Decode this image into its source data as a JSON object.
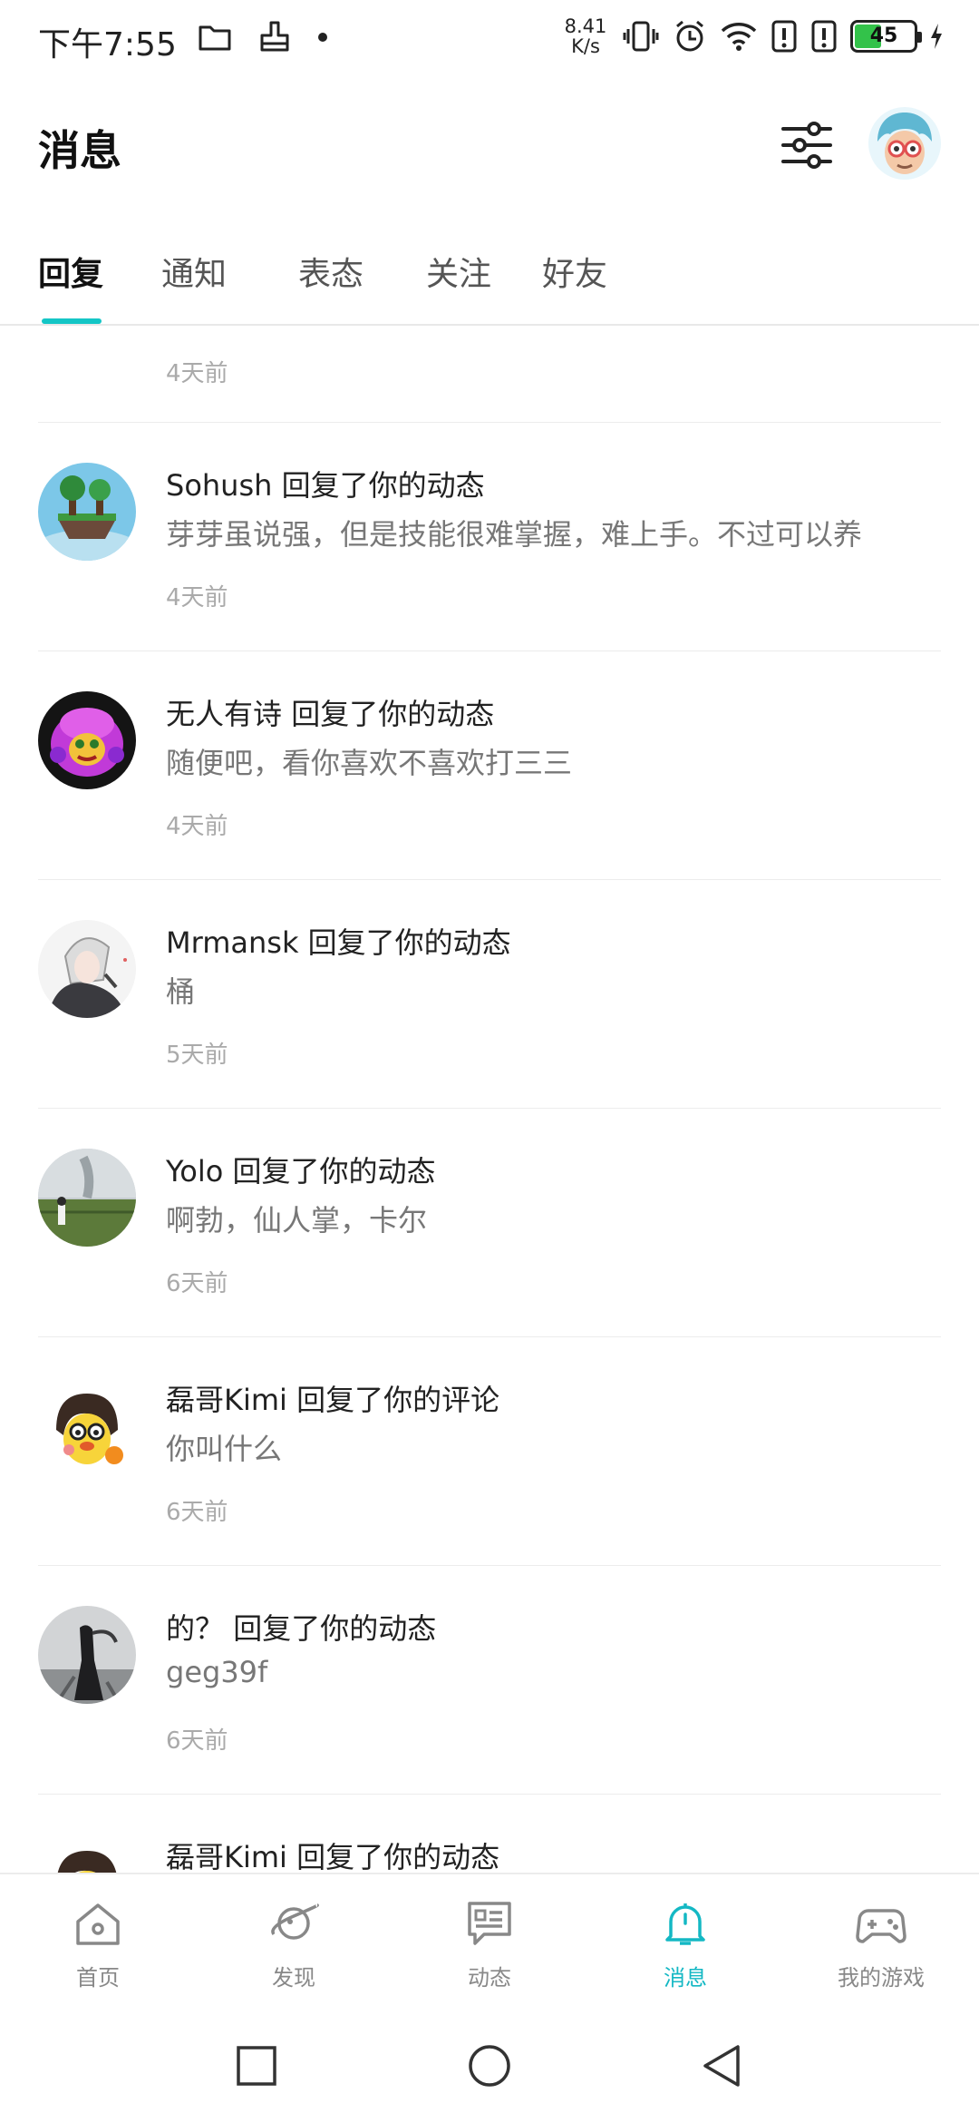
{
  "status_bar": {
    "time": "下午7:55",
    "net_speed": "8.41",
    "net_unit": "K/s",
    "battery": "45",
    "battery_color": "#33c24a"
  },
  "header": {
    "title": "消息"
  },
  "tabs": [
    {
      "label": "回复",
      "active": true
    },
    {
      "label": "通知",
      "active": false
    },
    {
      "label": "表态",
      "active": false
    },
    {
      "label": "关注",
      "active": false
    },
    {
      "label": "好友",
      "active": false
    }
  ],
  "accent_color": "#14c6c6",
  "feed": {
    "first_time": "4天前",
    "messages": [
      {
        "user": "Sohush",
        "action": "回复了你的动态",
        "body": "芽芽虽说强，但是技能很难掌握，难上手。不过可以养",
        "time": "4天前"
      },
      {
        "user": "无人有诗",
        "action": "回复了你的动态",
        "body": "随便吧，看你喜欢不喜欢打三三",
        "time": "4天前"
      },
      {
        "user": "Mrmansk",
        "action": "回复了你的动态",
        "body": "桶",
        "time": "5天前"
      },
      {
        "user": "Yolo",
        "action": "回复了你的动态",
        "body": "啊勃，仙人掌，卡尔",
        "time": "6天前"
      },
      {
        "user": "磊哥Kimi",
        "action": "回复了你的评论",
        "body": "你叫什么",
        "time": "6天前"
      },
      {
        "user": "的？",
        "action": "回复了你的动态",
        "body": "geg39f",
        "time": "6天前"
      },
      {
        "user": "磊哥Kimi",
        "action": "回复了你的动态",
        "body": "",
        "time": ""
      }
    ]
  },
  "bottom_nav": [
    {
      "label": "首页",
      "icon": "home-icon"
    },
    {
      "label": "发现",
      "icon": "planet-icon"
    },
    {
      "label": "动态",
      "icon": "feed-icon"
    },
    {
      "label": "消息",
      "icon": "bell-icon",
      "active": true
    },
    {
      "label": "我的游戏",
      "icon": "gamepad-icon"
    }
  ]
}
